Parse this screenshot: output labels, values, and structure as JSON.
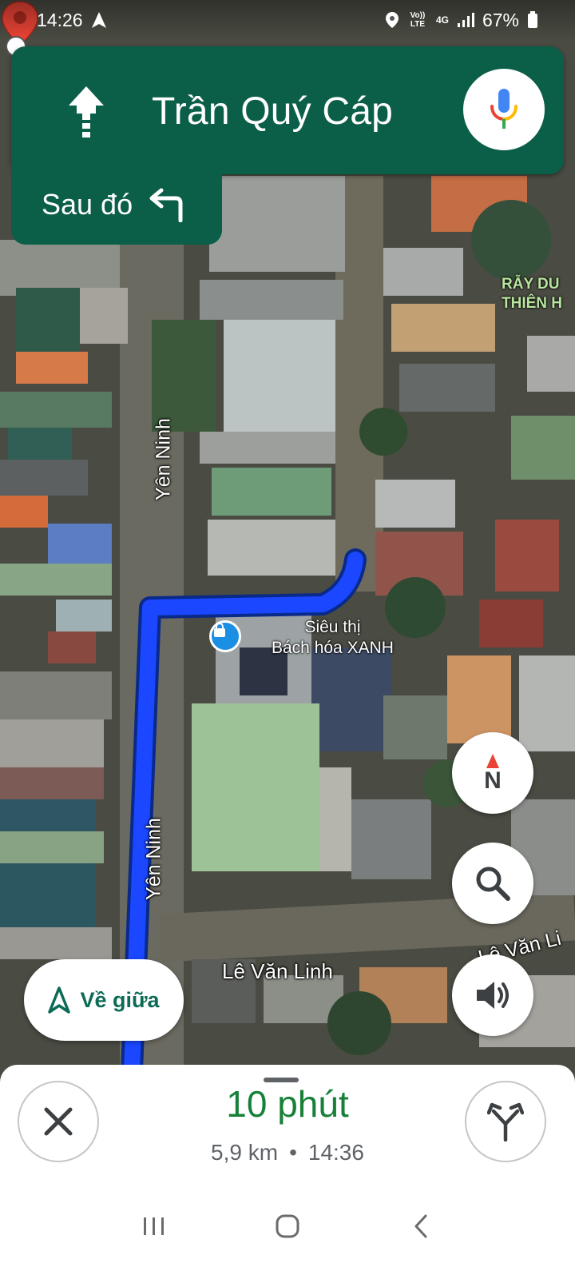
{
  "status_bar": {
    "time": "14:26",
    "network_lte": "Vo)) LTE",
    "network_4g": "4G",
    "battery": "67%"
  },
  "navigation": {
    "street": "Trần Quý Cáp",
    "then_label": "Sau đó",
    "maneuver_icon": "straight-arrow-icon",
    "next_maneuver_icon": "turn-left-arrow-icon"
  },
  "map": {
    "road_labels": [
      "Yên Ninh",
      "Yên Ninh",
      "Lê Văn Linh",
      "Lê Văn Li"
    ],
    "place_label_line1": "RẪY DU",
    "place_label_line2": "THIÊN H",
    "poi_name_line1": "Siêu thị",
    "poi_name_line2": "Bách hóa XANH",
    "route_color": "#1a47ff"
  },
  "controls": {
    "compass_label": "N",
    "recenter_label": "Về giữa"
  },
  "trip": {
    "duration": "10 phút",
    "distance": "5,9 km",
    "arrival_time": "14:36",
    "separator": "•"
  },
  "colors": {
    "header_green": "#0b5e48",
    "eta_green": "#188038",
    "pin_red": "#ea4335"
  }
}
